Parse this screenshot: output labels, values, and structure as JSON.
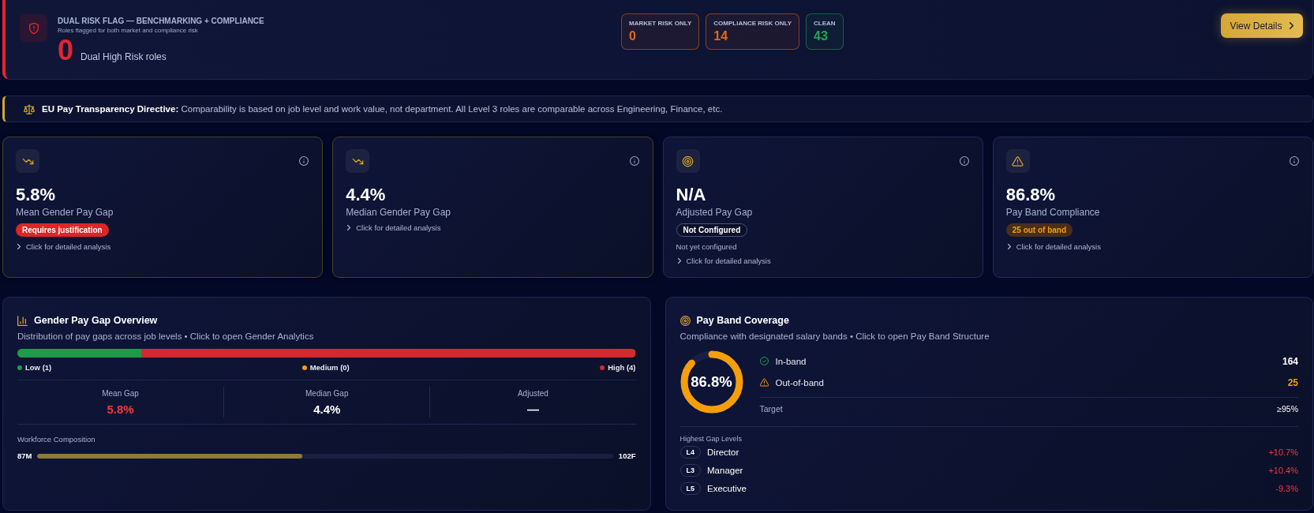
{
  "risk_flag": {
    "title": "DUAL RISK FLAG — BENCHMARKING + COMPLIANCE",
    "subtitle": "Roles flagged for both market and compliance risk",
    "count": "0",
    "count_label": "Dual High Risk roles",
    "pills": [
      {
        "label": "MARKET RISK ONLY",
        "value": "0",
        "color": "#e0691c"
      },
      {
        "label": "COMPLIANCE RISK ONLY",
        "value": "14",
        "color": "#e0691c"
      },
      {
        "label": "CLEAN",
        "value": "43",
        "color": "#22a652"
      }
    ],
    "button": "View Details"
  },
  "notice": {
    "text": "**EU Pay Transparency Directive:** Comparability is based on job level and work value, not department. All Level 3 roles are comparable across Engineering, Finance, etc."
  },
  "kpi_cards": [
    {
      "kind": "gap",
      "flagged": true,
      "value": "5.8%",
      "label": "Mean Gender Pay Gap",
      "badge": {
        "kind": "danger",
        "text": "Requires justification"
      },
      "link": "Click for detailed analysis"
    },
    {
      "kind": "gap",
      "flagged": true,
      "value": "4.4%",
      "label": "Median Gender Pay Gap",
      "link": "Click for detailed analysis"
    },
    {
      "kind": "adjusted",
      "flagged": false,
      "value": "N/A",
      "label": "Adjusted Pay Gap",
      "badge": {
        "kind": "neutral",
        "text": "Not Configured"
      },
      "note": "Not yet configured",
      "link": "Click for detailed analysis"
    },
    {
      "kind": "band",
      "flagged": false,
      "value": "86.8%",
      "label": "Pay Band Compliance",
      "badge": {
        "kind": "warning",
        "text": "25 out of band"
      },
      "link": "Click for detailed analysis"
    }
  ],
  "gender_overview": {
    "title": "Gender Pay Gap Overview",
    "subtitle": "Distribution of pay gaps across job levels • Click to open Gender Analytics",
    "distribution": [
      {
        "label": "Low (1)",
        "level": 0.2,
        "color": "#1f9a4b"
      },
      {
        "label": "Medium (0)",
        "color": "#f59e0b"
      },
      {
        "label": "High (4)",
        "level": 0.8,
        "color": "#d42a2f"
      }
    ],
    "stats": [
      {
        "label": "Mean Gap",
        "value": "5.8%",
        "color": "#ef3b3b"
      },
      {
        "label": "Median Gap",
        "value": "4.4%",
        "color": "#ffffff"
      },
      {
        "label": "Adjusted",
        "value": "—",
        "color": "#ffffff"
      }
    ],
    "workforce": {
      "label": "Workforce Composition",
      "left": "87M",
      "right": "102F",
      "level": 0.46
    }
  },
  "pay_band": {
    "title": "Pay Band Coverage",
    "subtitle": "Compliance with designated salary bands • Click to open Pay Band Structure",
    "donut": {
      "label": "86.8%",
      "level": 0.868
    },
    "rows": [
      {
        "kind": "ok",
        "label": "In-band",
        "value": "164"
      },
      {
        "kind": "warn",
        "label": "Out-of-band",
        "value": "25"
      }
    ],
    "target": {
      "label": "Target",
      "value": "≥95%"
    },
    "levels_title": "Highest Gap Levels",
    "levels": [
      {
        "code": "L4",
        "name": "Director",
        "gap": "+10.7%"
      },
      {
        "code": "L3",
        "name": "Manager",
        "gap": "+10.4%"
      },
      {
        "code": "L5",
        "name": "Executive",
        "gap": "-9.3%"
      }
    ]
  }
}
